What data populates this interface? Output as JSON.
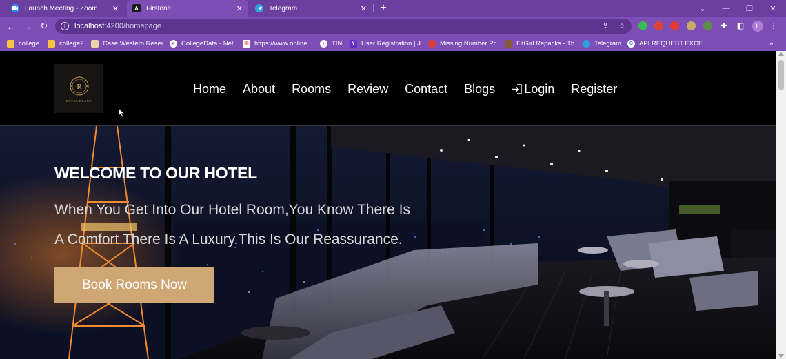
{
  "tabs": [
    {
      "title": "Launch Meeting - Zoom",
      "icon": "zoom-icon",
      "color": "#2d8cff"
    },
    {
      "title": "Firstone",
      "icon": "angular-icon",
      "color": "#1a1a1a",
      "active": true
    },
    {
      "title": "Telegram",
      "icon": "telegram-icon",
      "color": "#2aa3e0"
    }
  ],
  "address_bar": {
    "host": "localhost",
    "path": ":4200/homepage"
  },
  "bookmarks": [
    {
      "label": "college",
      "icon": "folder-icon"
    },
    {
      "label": "college2",
      "icon": "folder-icon"
    },
    {
      "label": "Case Western Reser...",
      "icon": "case-western-icon"
    },
    {
      "label": "CollegeData - Net...",
      "icon": "collegedata-icon"
    },
    {
      "label": "https://www.online...",
      "icon": "online-icon"
    },
    {
      "label": "TIN",
      "icon": "tin-icon"
    },
    {
      "label": "User Registration | J...",
      "icon": "yahoo-icon"
    },
    {
      "label": "Missing Number Pr...",
      "icon": "bug-icon"
    },
    {
      "label": "FitGirl Repacks - Th...",
      "icon": "fitgirl-icon"
    },
    {
      "label": "Telegram",
      "icon": "telegram-icon"
    },
    {
      "label": "API REQUEST EXCE...",
      "icon": "google-icon"
    }
  ],
  "profile_initial": "L",
  "site": {
    "logo_text": "ROYAL BRAND",
    "nav": [
      "Home",
      "About",
      "Rooms",
      "Review",
      "Contact",
      "Blogs",
      "Login",
      "Register"
    ],
    "hero": {
      "title": "WELCOME TO OUR HOTEL",
      "subtitle_line1": "When You Get Into Our Hotel Room,You Know There Is",
      "subtitle_line2": "A Comfort There Is A Luxury.This Is Our Reassurance.",
      "cta": "Book Rooms Now"
    }
  },
  "colors": {
    "chrome_purple": "#7d4fb6",
    "tabstrip_purple": "#6b3fa0",
    "cta_gold": "#cfa774",
    "header_bg": "#000000"
  }
}
